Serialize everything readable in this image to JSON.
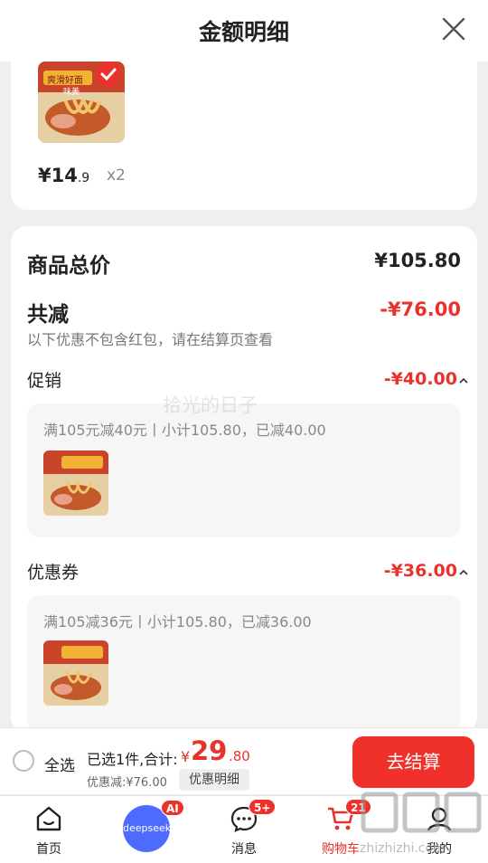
{
  "header": {
    "title": "金额明细"
  },
  "product": {
    "price_int": "¥14",
    "price_dec": ".9",
    "qty": "x2",
    "img_text_1": "爽滑好面",
    "img_text_2": "味美"
  },
  "summary": {
    "total_label": "商品总价",
    "total_value": "¥105.80",
    "reduce_label": "共减",
    "reduce_value": "-¥76.00",
    "note": "以下优惠不包含红包，请在结算页查看"
  },
  "promotions": [
    {
      "label": "促销",
      "value": "-¥40.00",
      "desc": "满105元减40元丨小计105.80，已减40.00"
    },
    {
      "label": "优惠券",
      "value": "-¥36.00",
      "desc": "满105减36元丨小计105.80，已减36.00"
    }
  ],
  "watermark": "拾光的日子",
  "checkout": {
    "select_all": "全选",
    "selected": "已选1件,合计:",
    "currency": "¥",
    "total_int": "29",
    "total_dec": ".80",
    "discount": "优惠减:¥76.00",
    "detail_btn": "优惠明细",
    "checkout_btn": "去结算"
  },
  "tabs": [
    {
      "label": "首页",
      "icon": "home-icon"
    },
    {
      "label": "deepseek",
      "icon": "deepseek-icon",
      "badge": "AI"
    },
    {
      "label": "消息",
      "icon": "message-icon",
      "badge": "5+"
    },
    {
      "label": "购物车",
      "icon": "cart-icon",
      "badge": "21"
    },
    {
      "label": "我的",
      "icon": "profile-icon"
    }
  ],
  "brand_watermark": "zhizhizhi.com",
  "colors": {
    "accent": "#e8322b",
    "checkout_button": "#f0302a",
    "deepseek": "#4d6bfe"
  }
}
